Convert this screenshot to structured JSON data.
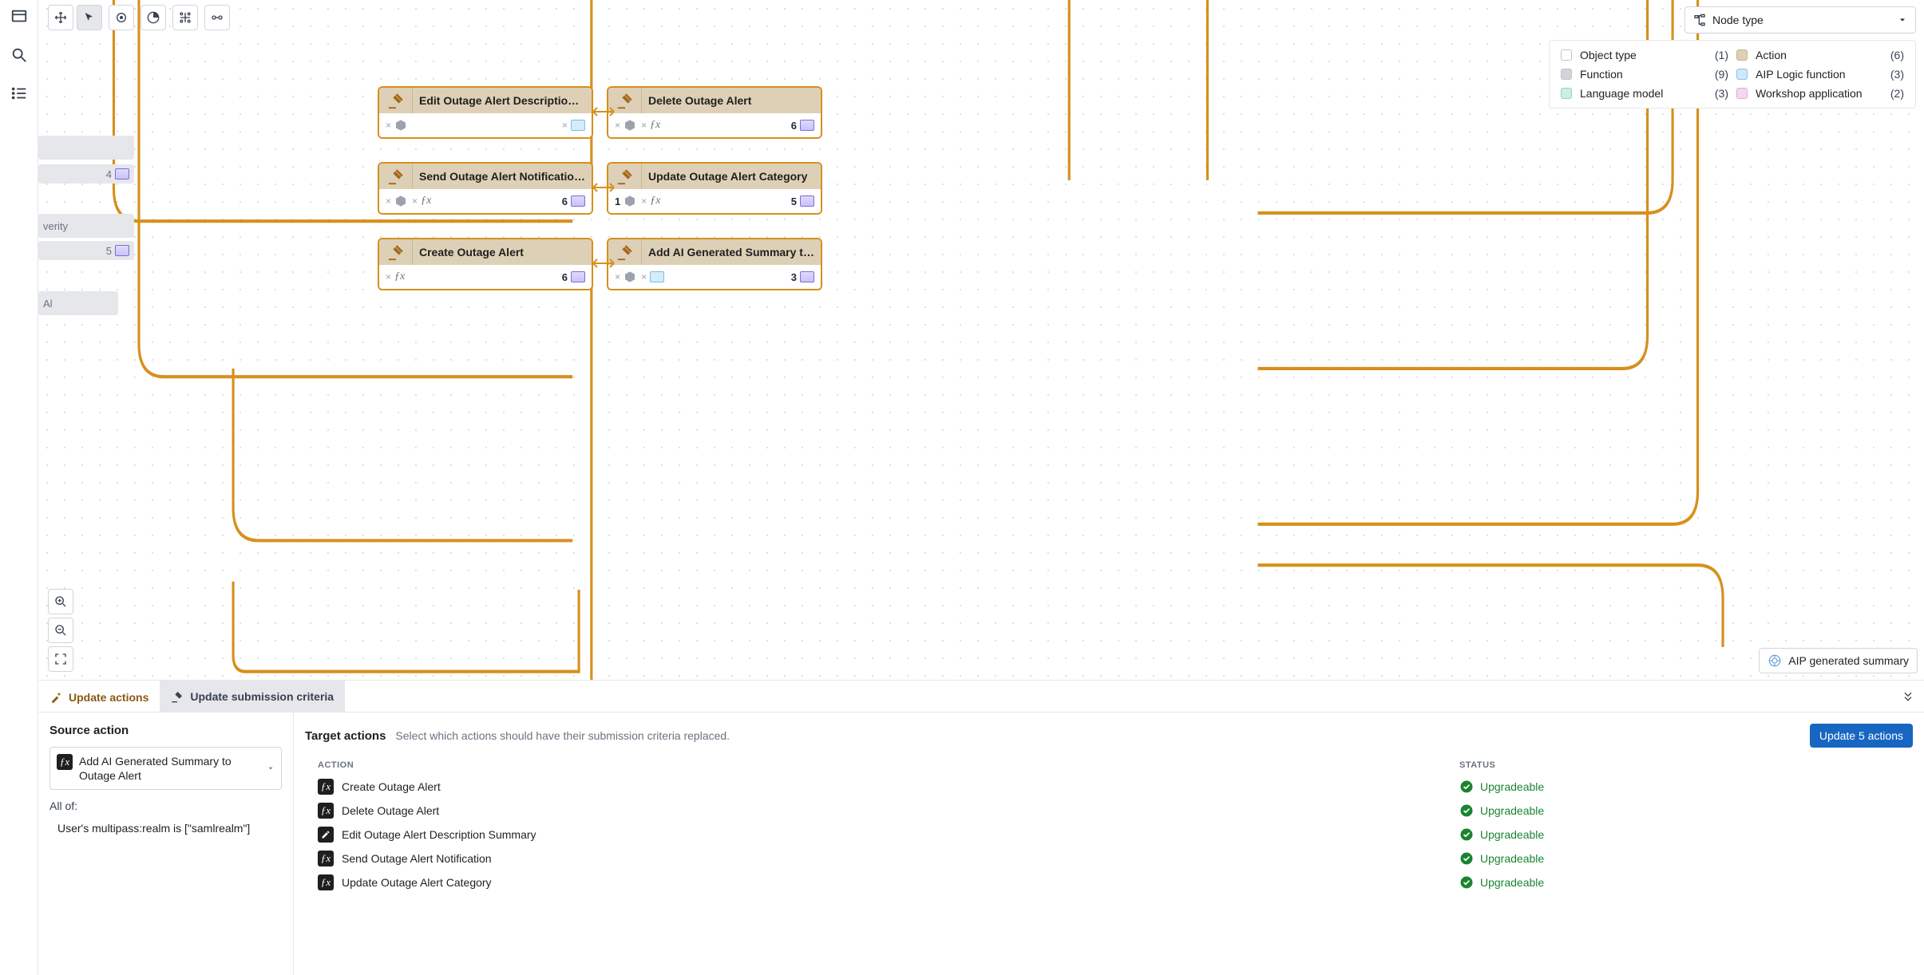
{
  "nodeTypeLabel": "Node type",
  "legend": {
    "objectType": {
      "label": "Object type",
      "count": "(1)",
      "color": "#ffffff"
    },
    "action": {
      "label": "Action",
      "count": "(6)",
      "color": "#ded0b7"
    },
    "function": {
      "label": "Function",
      "count": "(9)",
      "color": "#d1d5db"
    },
    "aipLogic": {
      "label": "AIP Logic function",
      "count": "(3)",
      "color": "#cfe7fb"
    },
    "language": {
      "label": "Language model",
      "count": "(3)",
      "color": "#cdeee5"
    },
    "workshop": {
      "label": "Workshop application",
      "count": "(2)",
      "color": "#f5d8ef"
    }
  },
  "faded": {
    "box1": {
      "num": "4"
    },
    "box2": {
      "label": "verity"
    },
    "box3": {
      "num": "5"
    },
    "box4": {
      "label": "Al"
    }
  },
  "aipChip": "AIP generated summary",
  "nodes": {
    "editDesc": {
      "title": "Edit Outage Alert Description …"
    },
    "deleteAlert": {
      "title": "Delete Outage Alert"
    },
    "sendNotif": {
      "title": "Send Outage Alert Notificatio…",
      "right_num": "6"
    },
    "updateCat": {
      "title": "Update Outage Alert Category",
      "left_num": "1",
      "right_num": "5"
    },
    "createAlert": {
      "title": "Create Outage Alert",
      "right_num": "6"
    },
    "addAI": {
      "title": "Add AI Generated Summary to…",
      "right_num": "3"
    },
    "deleteRight": {
      "num": "6"
    }
  },
  "tabs": {
    "updateActions": "Update actions",
    "updateCriteria": "Update submission criteria"
  },
  "sourceSection": {
    "heading": "Source action",
    "selected": "Add AI Generated Summary to Outage Alert",
    "allOf": "All of:",
    "rule": "User's multipass:realm is [\"samlrealm\"]"
  },
  "targetSection": {
    "heading": "Target actions",
    "hint": "Select which actions should have their submission criteria replaced.",
    "button": "Update 5 actions",
    "colAction": "ACTION",
    "colStatus": "STATUS",
    "rows": [
      {
        "icon": "fx",
        "name": "Create Outage Alert",
        "status": "Upgradeable"
      },
      {
        "icon": "fx",
        "name": "Delete Outage Alert",
        "status": "Upgradeable"
      },
      {
        "icon": "edit",
        "name": "Edit Outage Alert Description Summary",
        "status": "Upgradeable"
      },
      {
        "icon": "fx",
        "name": "Send Outage Alert Notification",
        "status": "Upgradeable"
      },
      {
        "icon": "fx",
        "name": "Update Outage Alert Category",
        "status": "Upgradeable"
      }
    ]
  }
}
